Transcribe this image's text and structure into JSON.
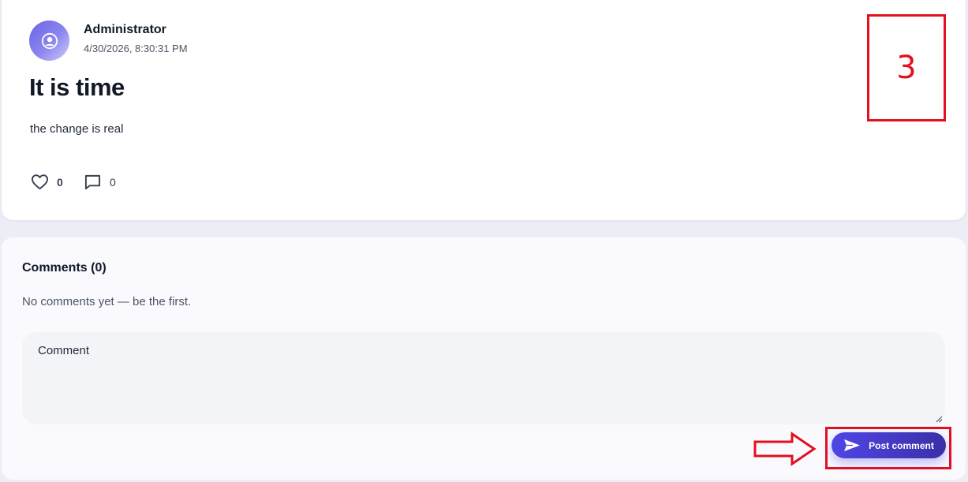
{
  "post": {
    "author": "Administrator",
    "timestamp": "4/30/2026, 8:30:31 PM",
    "title": "It is time",
    "body": "the change is real",
    "likes": "0",
    "comments_count": "0",
    "avatar_icon": "user-circle-icon",
    "like_icon": "heart-icon",
    "comment_icon": "chat-bubble-icon"
  },
  "comments": {
    "heading": "Comments (0)",
    "empty_text": "No comments yet — be the first.",
    "input_placeholder": "Comment",
    "input_value": "",
    "submit_label": "Post comment",
    "submit_icon": "send-icon"
  },
  "annotations": {
    "marker_label": "3",
    "color": "#e3101d"
  },
  "colors": {
    "accent": "#4f46e5",
    "page_bg": "#ededf8"
  }
}
